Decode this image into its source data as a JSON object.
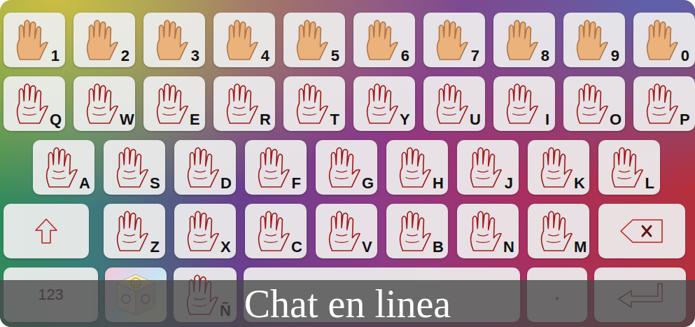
{
  "number_row": [
    "1",
    "2",
    "3",
    "4",
    "5",
    "6",
    "7",
    "8",
    "9",
    "0"
  ],
  "letter_rows": [
    [
      "Q",
      "W",
      "E",
      "R",
      "T",
      "Y",
      "U",
      "I",
      "O",
      "P"
    ],
    [
      "A",
      "S",
      "D",
      "F",
      "G",
      "H",
      "J",
      "K",
      "L"
    ],
    [
      "Z",
      "X",
      "C",
      "V",
      "B",
      "N",
      "M"
    ]
  ],
  "mode_key": "123",
  "extra_key": "Ñ",
  "period_key": ".",
  "banner": "Chat en linea"
}
